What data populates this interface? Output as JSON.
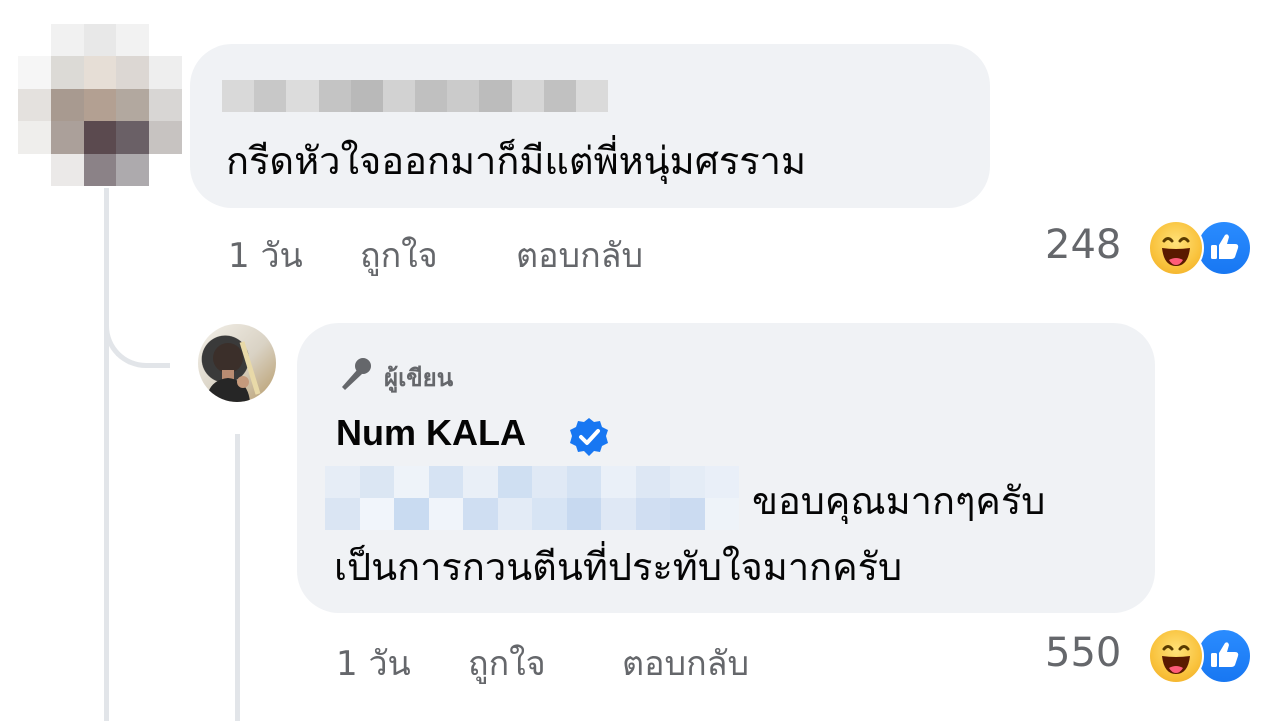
{
  "comment": {
    "text": "กรีดหัวใจออกมาก็มีแต่พี่หนุ่มศรราม",
    "time": "1 วัน",
    "like_label": "ถูกใจ",
    "reply_label": "ตอบกลับ",
    "reaction_count": "248"
  },
  "reply": {
    "badge": "ผู้เขียน",
    "author": "Num KALA",
    "line1": "ขอบคุณมากๆครับ",
    "line2": "เป็นการกวนตีนที่ประทับใจมากครับ",
    "time": "1 วัน",
    "like_label": "ถูกใจ",
    "reply_label": "ตอบกลับ",
    "reaction_count": "550"
  },
  "icons": {
    "reaction_1": "haha-emoji-icon",
    "reaction_2": "like-icon",
    "badge": "microphone-icon",
    "verified": "verified-badge-icon"
  },
  "colors": {
    "bubble": "#f0f2f5",
    "secondary_text": "#65676b",
    "like_blue": "#1877f2",
    "haha_yellow": "#f9c23c"
  }
}
